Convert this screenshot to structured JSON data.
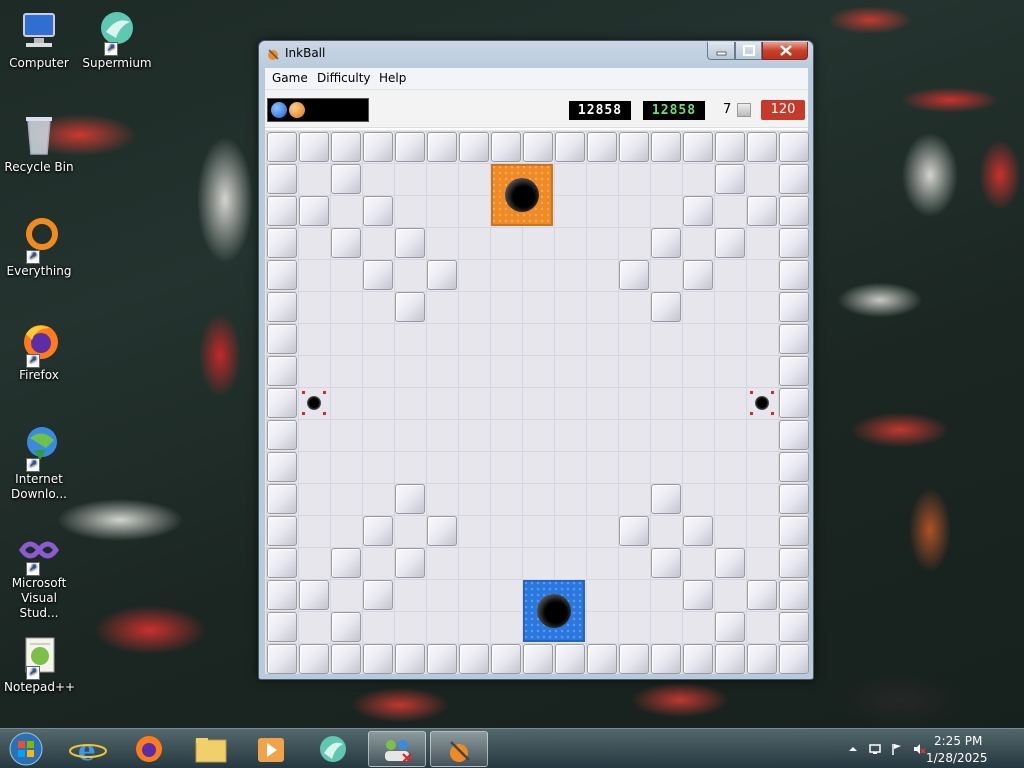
{
  "desktop": {
    "icons": [
      {
        "label": "Computer",
        "icon": "computer-icon"
      },
      {
        "label": "Supermium",
        "icon": "supermium-icon"
      },
      {
        "label": "Recycle Bin",
        "icon": "recycle-bin-icon"
      },
      {
        "label": "Everything",
        "icon": "everything-icon"
      },
      {
        "label": "Firefox",
        "icon": "firefox-icon"
      },
      {
        "label": "Internet Downlo...",
        "icon": "internet-download-manager-icon"
      },
      {
        "label": "Microsoft Visual Stud...",
        "icon": "visual-studio-icon"
      },
      {
        "label": "Notepad++",
        "icon": "notepad-plus-plus-icon"
      }
    ]
  },
  "window": {
    "title": "InkBall",
    "menu": [
      "Game",
      "Difficulty",
      "Help"
    ],
    "status": {
      "score": "12858",
      "high_score": "12858",
      "lives": "7",
      "timer": "120",
      "queued_balls": [
        "blue",
        "orange"
      ]
    }
  },
  "board": {
    "cols": 17,
    "rows": 17,
    "interior_walls": [
      [
        1,
        2
      ],
      [
        1,
        14
      ],
      [
        2,
        1
      ],
      [
        2,
        3
      ],
      [
        2,
        13
      ],
      [
        2,
        15
      ],
      [
        3,
        2
      ],
      [
        3,
        4
      ],
      [
        3,
        12
      ],
      [
        3,
        14
      ],
      [
        4,
        3
      ],
      [
        4,
        5
      ],
      [
        4,
        11
      ],
      [
        4,
        13
      ],
      [
        5,
        4
      ],
      [
        5,
        12
      ],
      [
        11,
        4
      ],
      [
        11,
        12
      ],
      [
        12,
        3
      ],
      [
        12,
        5
      ],
      [
        12,
        11
      ],
      [
        12,
        13
      ],
      [
        13,
        2
      ],
      [
        13,
        4
      ],
      [
        13,
        12
      ],
      [
        13,
        14
      ],
      [
        14,
        1
      ],
      [
        14,
        3
      ],
      [
        14,
        13
      ],
      [
        14,
        15
      ],
      [
        15,
        2
      ],
      [
        15,
        14
      ]
    ],
    "goals": [
      {
        "color": "orange",
        "row": 1,
        "col": 7
      },
      {
        "color": "blue",
        "row": 14,
        "col": 8
      }
    ],
    "spawners": [
      {
        "row": 8,
        "col": 1
      },
      {
        "row": 8,
        "col": 15
      }
    ],
    "colors": {
      "orange": "#f08a24",
      "blue": "#2a77e0",
      "wall": "#e6e6ee"
    }
  },
  "taskbar": {
    "apps": [
      "start-button",
      "internet-explorer-icon",
      "firefox-icon",
      "file-explorer-icon",
      "media-player-icon",
      "supermium-icon",
      "network-app-icon",
      "inkball-icon"
    ],
    "time": "2:25 PM",
    "date": "1/28/2025"
  }
}
